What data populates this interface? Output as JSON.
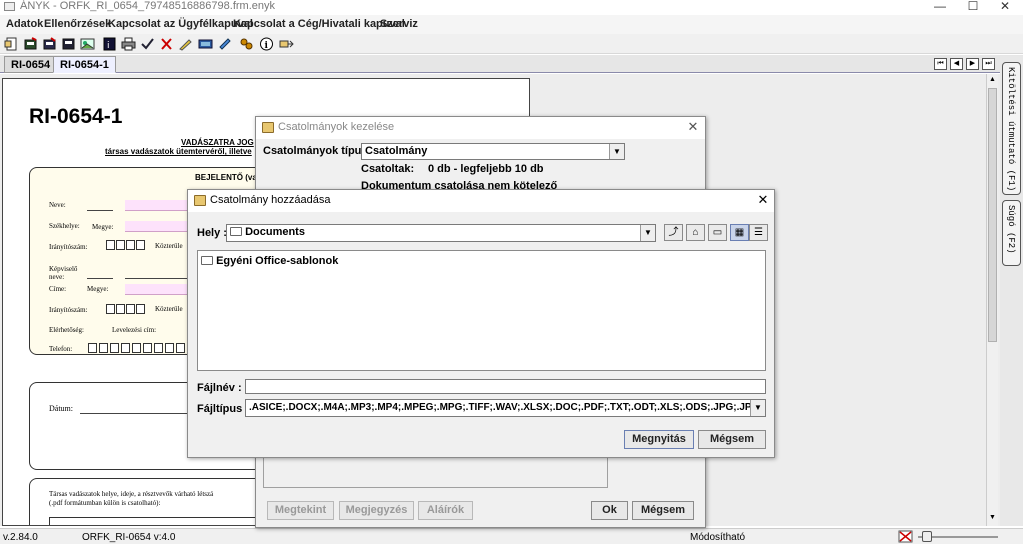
{
  "window": {
    "title": "ÁNYK - ORFK_RI_0654_79748516886798.frm.enyk",
    "min": "—",
    "max": "☐",
    "close": "✕"
  },
  "menu": [
    "Adatok",
    "Ellenőrzések",
    "Kapcsolat az Ügyfélkapuval",
    "Kapcsolat a Cég/Hivatali kapuval",
    "Szerviz"
  ],
  "tabs": [
    {
      "label": "RI-0654"
    },
    {
      "label": "RI-0654-1"
    }
  ],
  "nav": [
    "⏮",
    "◀",
    "▶",
    "⏭"
  ],
  "form": {
    "title": "RI-0654-1",
    "subtitle1": "VADÁSZATRA JOG",
    "subtitle2": "társas vadászatok ütemtervéről, illetve",
    "section1_title": "BEJELENTŐ (vad",
    "labels": {
      "neve": "Neve:",
      "szekhelye": "Székhelye:",
      "megye1": "Megye:",
      "iranyitoszam1": "Irányítószám:",
      "kozterulet1": "Közterüle",
      "kepviselo": "Képviselő",
      "kepviselo2": "neve:",
      "cime": "Címe:",
      "megye2": "Megye:",
      "iranyitoszam2": "Irányítószám:",
      "kozterulet2": "Közterüle",
      "elerhetoseg": "Elérhetőség:",
      "levelezesi": "Levelezési cím:",
      "telefon": "Telefon:",
      "datum": "Dátum:",
      "tarsas1": "Társas vadászatok helye, ideje, a résztvevők várható létszá",
      "tarsas2": "(.pdf formátumban külön is csatolható):"
    }
  },
  "sidepanel": {
    "tab1": "Kitöltési útmutató (F1)",
    "tab2": "Súgó (F2)"
  },
  "status": {
    "version": "v.2.84.0",
    "form": "ORFK_RI-0654 v:4.0",
    "mode": "Módosítható"
  },
  "attachments_dialog": {
    "title": "Csatolmányok kezelése",
    "type_label": "Csatolmányok típusa:",
    "type_value": "Csatolmány",
    "attached_label": "Csatoltak:",
    "attached_value": "0 db - legfeljebb 10 db",
    "note": "Dokumentum csatolása nem kötelező",
    "buttons": {
      "view": "Megtekint",
      "comment": "Megjegyzés",
      "signers": "Aláírók",
      "ok": "Ok",
      "cancel": "Mégsem"
    }
  },
  "add_dialog": {
    "title": "Csatolmány hozzáadása",
    "location_label": "Hely :",
    "location_value": "Documents",
    "files": [
      "Egyéni Office-sablonok"
    ],
    "filename_label": "Fájlnév :",
    "filename_value": "",
    "filetype_label": "Fájltípus :",
    "filetype_value": ".ASICE;.DOCX;.M4A;.MP3;.MP4;.MPEG;.MPG;.TIFF;.WAV;.XLSX;.DOC;.PDF;.TXT;.ODT;.XLS;.ODS;.JPG;.JPEG;.TIF;.PNG fájlok",
    "open": "Megnyitás",
    "cancel": "Mégsem",
    "tool_icons": [
      "up-folder-icon",
      "home-icon",
      "new-folder-icon",
      "list-view-icon",
      "details-view-icon"
    ]
  }
}
